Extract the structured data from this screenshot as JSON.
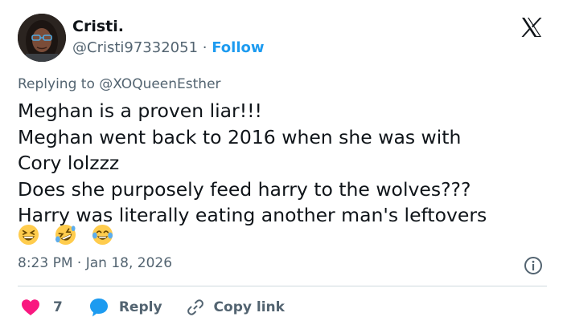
{
  "author": {
    "display_name": "Cristi.",
    "handle": "@Cristi97332051",
    "separator": "·",
    "follow_label": "Follow"
  },
  "reply_context": {
    "prefix": "Replying to",
    "handle": "@XOQueenEsther"
  },
  "body": {
    "lines": [
      "Meghan is a proven liar!!!",
      "Meghan went back to 2016 when she was with",
      "Cory lolzzz",
      "Does she purposely feed harry to the wolves???",
      "Harry was literally eating another man's leftovers"
    ],
    "emojis": [
      "grinning-squinting-face",
      "rolling-on-floor-laughing",
      "face-with-tears-of-joy"
    ]
  },
  "timestamp": "8:23 PM · Jan 18, 2026",
  "actions": {
    "like_count": "7",
    "reply_label": "Reply",
    "copy_link_label": "Copy link"
  },
  "colors": {
    "accent": "#1d9bf0",
    "like": "#f91880",
    "secondary_text": "#536471",
    "primary_text": "#0f1419",
    "divider": "#cfd9de"
  },
  "icons": {
    "brand": "x-logo-icon",
    "info": "info-icon",
    "like": "heart-icon",
    "reply": "speech-bubble-icon",
    "copy_link": "link-icon"
  }
}
